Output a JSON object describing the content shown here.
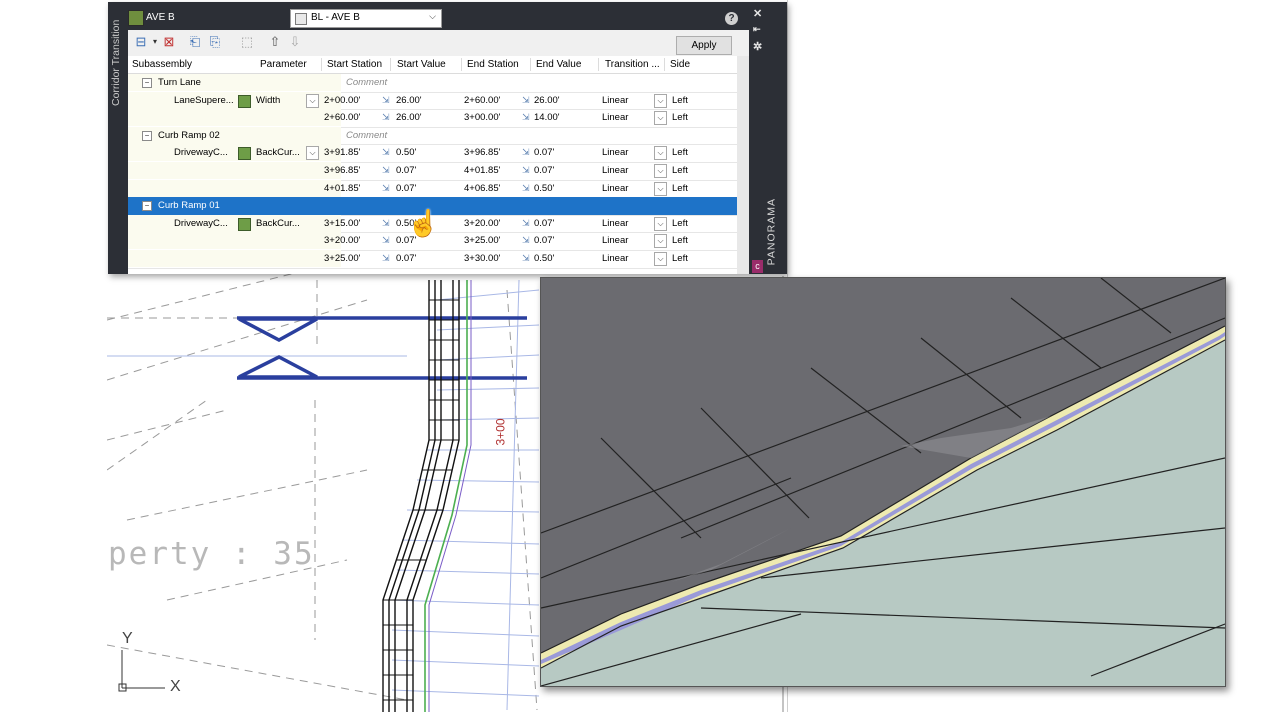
{
  "palette": {
    "side_tab_label": "Corridor Transition",
    "corridor_name": "AVE B",
    "baseline_select": "BL - AVE B",
    "apply_label": "Apply",
    "help_glyph": "?",
    "panorama_label": "PANORAMA",
    "corner_tag": "c",
    "columns": [
      "Subassembly",
      "Parameter",
      "Start Station",
      "Start Value",
      "End Station",
      "End Value",
      "Transition ...",
      "Side"
    ],
    "comment_placeholder": "Comment",
    "groups": [
      {
        "name": "Turn Lane",
        "subassembly": "LaneSupere...",
        "parameter": "Width",
        "rows": [
          {
            "start_station": "2+00.00'",
            "start_value": "26.00'",
            "end_station": "2+60.00'",
            "end_value": "26.00'",
            "transition": "Linear",
            "side": "Left"
          },
          {
            "start_station": "2+60.00'",
            "start_value": "26.00'",
            "end_station": "3+00.00'",
            "end_value": "14.00'",
            "transition": "Linear",
            "side": "Left"
          }
        ]
      },
      {
        "name": "Curb Ramp 02",
        "subassembly": "DrivewayC...",
        "parameter": "BackCur...",
        "rows": [
          {
            "start_station": "3+91.85'",
            "start_value": "0.50'",
            "end_station": "3+96.85'",
            "end_value": "0.07'",
            "transition": "Linear",
            "side": "Left"
          },
          {
            "start_station": "3+96.85'",
            "start_value": "0.07'",
            "end_station": "4+01.85'",
            "end_value": "0.07'",
            "transition": "Linear",
            "side": "Left"
          },
          {
            "start_station": "4+01.85'",
            "start_value": "0.07'",
            "end_station": "4+06.85'",
            "end_value": "0.50'",
            "transition": "Linear",
            "side": "Left"
          }
        ]
      },
      {
        "name": "Curb Ramp 01",
        "subassembly": "DrivewayC...",
        "parameter": "BackCur...",
        "rows": [
          {
            "start_station": "3+15.00'",
            "start_value": "0.50'",
            "end_station": "3+20.00'",
            "end_value": "0.07'",
            "transition": "Linear",
            "side": "Left"
          },
          {
            "start_station": "3+20.00'",
            "start_value": "0.07'",
            "end_station": "3+25.00'",
            "end_value": "0.07'",
            "transition": "Linear",
            "side": "Left"
          },
          {
            "start_station": "3+25.00'",
            "start_value": "0.07'",
            "end_station": "3+30.00'",
            "end_value": "0.50'",
            "transition": "Linear",
            "side": "Left"
          }
        ]
      }
    ]
  },
  "drawing": {
    "station_label": "3+00",
    "property_text": "perty : 35",
    "ucs_y": "Y",
    "ucs_x": "X"
  },
  "colors": {
    "palette_frame": "#2c2f36",
    "selection": "#1e73c8",
    "alignment_blue": "#2a3f9e",
    "station_red": "#b03030",
    "curb_yellow": "#eeeab0",
    "curb_purple": "#9a9ad8",
    "surface_gray": "#6b6b70",
    "ground_teal": "#b7c9c3"
  }
}
